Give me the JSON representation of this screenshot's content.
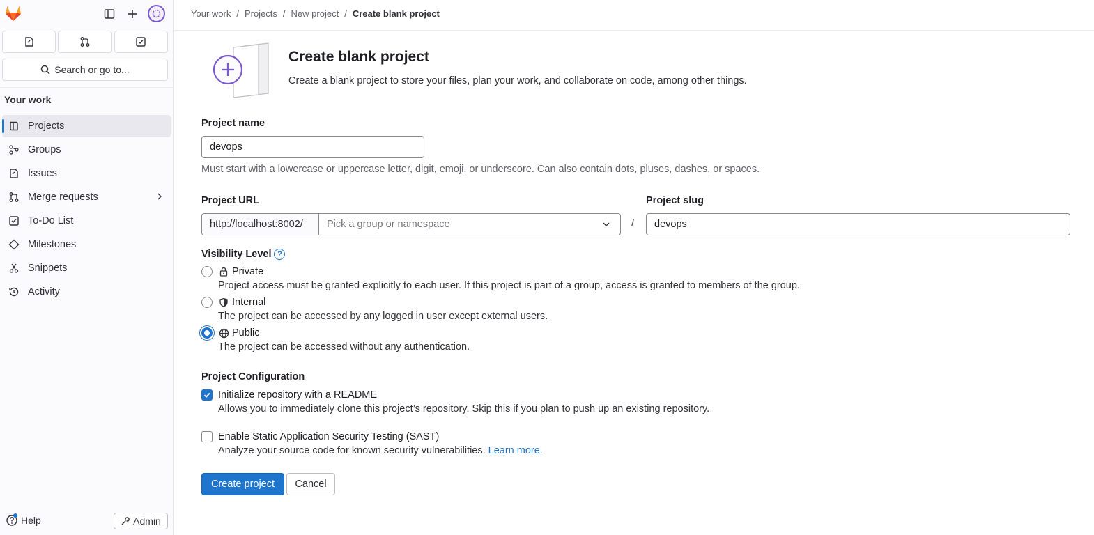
{
  "sidebar": {
    "search_label": "Search or go to...",
    "section_title": "Your work",
    "items": [
      {
        "label": "Projects",
        "icon": "project-icon",
        "active": true
      },
      {
        "label": "Groups",
        "icon": "group-icon"
      },
      {
        "label": "Issues",
        "icon": "issues-icon"
      },
      {
        "label": "Merge requests",
        "icon": "merge-request-icon",
        "has_chevron": true
      },
      {
        "label": "To-Do List",
        "icon": "todo-icon"
      },
      {
        "label": "Milestones",
        "icon": "milestone-icon"
      },
      {
        "label": "Snippets",
        "icon": "snippet-icon"
      },
      {
        "label": "Activity",
        "icon": "history-icon"
      }
    ],
    "help_label": "Help",
    "admin_label": "Admin"
  },
  "breadcrumb": {
    "items": [
      "Your work",
      "Projects",
      "New project"
    ],
    "current": "Create blank project",
    "separator": "/"
  },
  "header": {
    "title": "Create blank project",
    "description": "Create a blank project to store your files, plan your work, and collaborate on code, among other things."
  },
  "form": {
    "project_name": {
      "label": "Project name",
      "value": "devops",
      "help": "Must start with a lowercase or uppercase letter, digit, emoji, or underscore. Can also contain dots, pluses, dashes, or spaces."
    },
    "project_url": {
      "label": "Project URL",
      "prefix": "http://localhost:8002/",
      "namespace_placeholder": "Pick a group or namespace",
      "separator": "/"
    },
    "project_slug": {
      "label": "Project slug",
      "value": "devops"
    },
    "visibility": {
      "label": "Visibility Level",
      "help_icon": "?",
      "options": [
        {
          "label": "Private",
          "icon": "lock-icon",
          "description": "Project access must be granted explicitly to each user. If this project is part of a group, access is granted to members of the group.",
          "checked": false
        },
        {
          "label": "Internal",
          "icon": "shield-icon",
          "description": "The project can be accessed by any logged in user except external users.",
          "checked": false
        },
        {
          "label": "Public",
          "icon": "earth-icon",
          "description": "The project can be accessed without any authentication.",
          "checked": true
        }
      ]
    },
    "configuration": {
      "label": "Project Configuration",
      "readme": {
        "label": "Initialize repository with a README",
        "description": "Allows you to immediately clone this project’s repository. Skip this if you plan to push up an existing repository.",
        "checked": true
      },
      "sast": {
        "label": "Enable Static Application Security Testing (SAST)",
        "description": "Analyze your source code for known security vulnerabilities.",
        "link": "Learn more.",
        "checked": false
      }
    },
    "submit_label": "Create project",
    "cancel_label": "Cancel"
  },
  "colors": {
    "accent": "#1f75cb",
    "illustration": "#7b58cf"
  }
}
